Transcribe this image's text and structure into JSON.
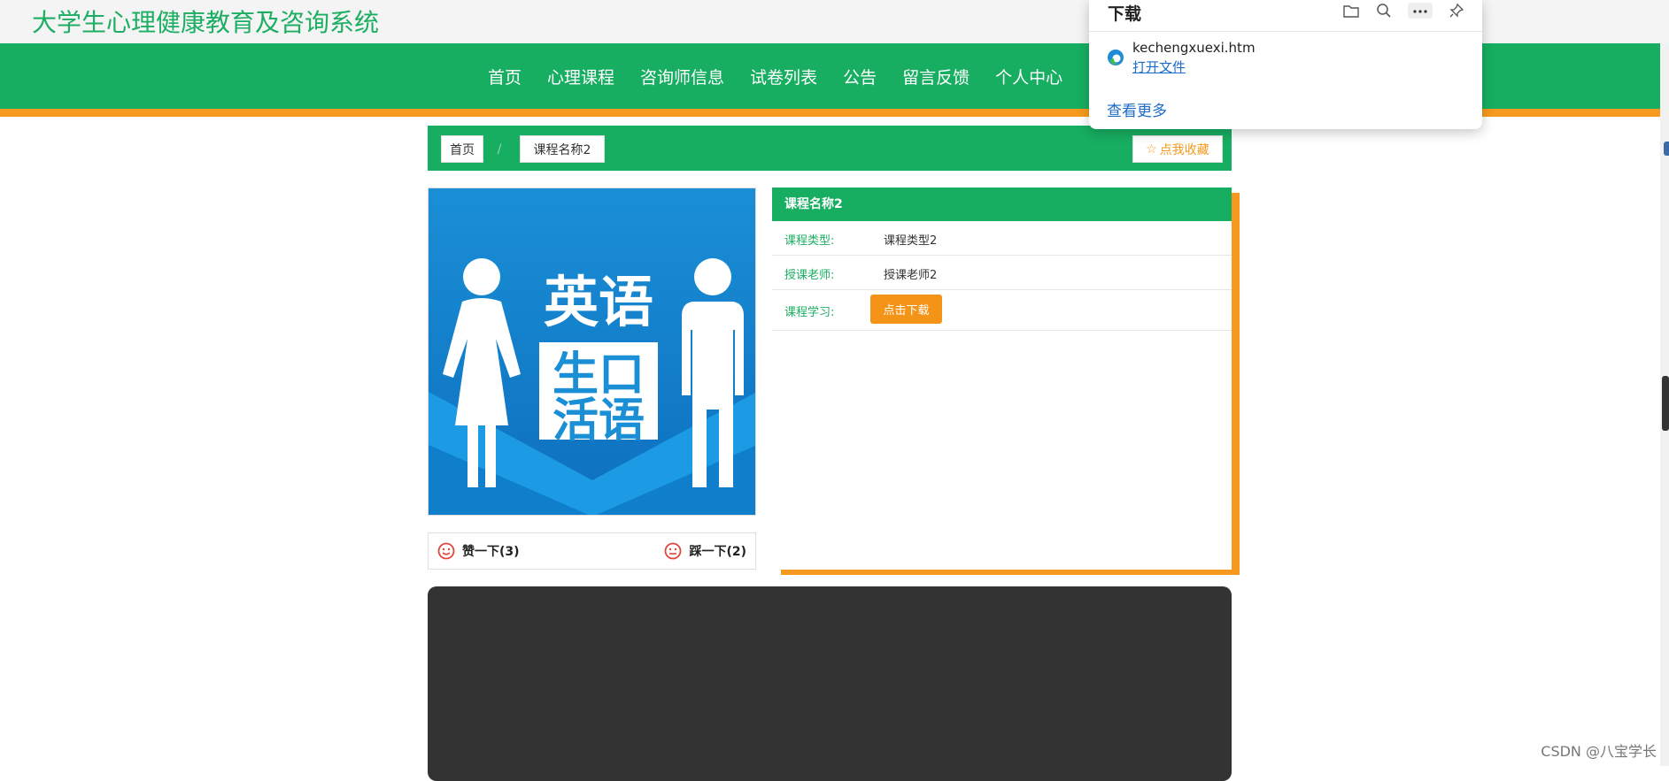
{
  "site": {
    "title": "大学生心理健康教育及咨询系统"
  },
  "nav": {
    "items": [
      "首页",
      "心理课程",
      "咨询师信息",
      "试卷列表",
      "公告",
      "留言反馈",
      "个人中心"
    ]
  },
  "breadcrumb": {
    "home": "首页",
    "separator": "/",
    "current": "课程名称2",
    "favorite_label": "点我收藏"
  },
  "course": {
    "image": {
      "title_line1": "英语",
      "title_line2": "生口",
      "title_line3": "活语"
    },
    "name": "课程名称2",
    "rows": [
      {
        "label": "课程类型:",
        "value": "课程类型2"
      },
      {
        "label": "授课老师:",
        "value": "授课老师2"
      }
    ],
    "study_label": "课程学习:",
    "download_button": "点击下载"
  },
  "votes": {
    "like": "赞一下(3)",
    "dislike": "踩一下(2)"
  },
  "download_panel": {
    "title": "下载",
    "file_name": "kechengxuexi.htm",
    "open_file": "打开文件",
    "see_more": "查看更多",
    "icons": [
      "folder-icon",
      "search-icon",
      "more-icon",
      "pin-icon"
    ]
  },
  "watermark": "CSDN @八宝学长",
  "colors": {
    "brand_green": "#17ae61",
    "accent_orange": "#f59a1e",
    "link_blue": "#1b6bc9"
  }
}
